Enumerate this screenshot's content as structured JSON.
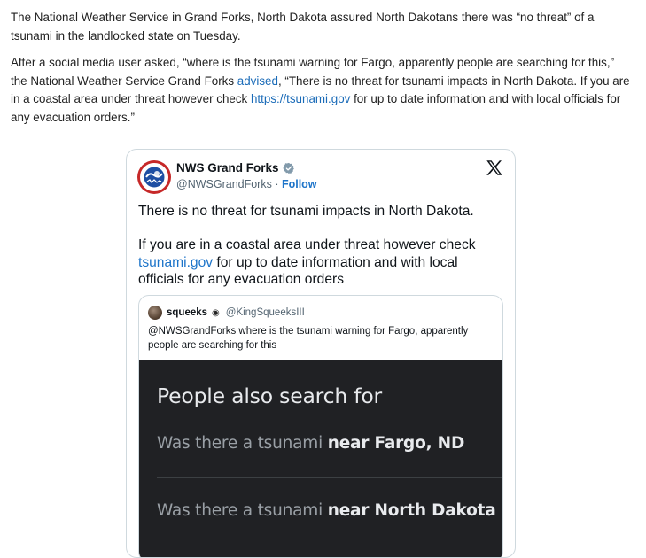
{
  "article": {
    "para1": "The National Weather Service in Grand Forks, North Dakota assured North Dakotans there was “no threat” of a tsunami in the landlocked state on Tuesday.",
    "para2_before": "After a social media user asked, “where is the tsunami warning for Fargo, apparently people are searching for this,” the National Weather Service Grand Forks ",
    "para2_link1": "advised",
    "para2_mid": ", “There is no threat for tsunami impacts in North Dakota. If you are in a coastal area under threat however check ",
    "para2_link2": "https://tsunami.gov",
    "para2_after": " for up to date information and with local officials for any evacuation orders.”"
  },
  "tweet": {
    "author_name": "NWS Grand Forks",
    "handle": "@NWSGrandForks",
    "separator": " · ",
    "follow_label": "Follow",
    "text_p1": "There is no threat for tsunami impacts in North Dakota.",
    "text_p2_before": "If you are in a coastal area under threat however check ",
    "text_p2_link": "tsunami.gov",
    "text_p2_after": " up to date information and with local officials for any evacuation orders",
    "text_p2_for": "for"
  },
  "quote": {
    "author_name": "squeeks",
    "badge": "◉",
    "handle": "@KingSqueeksIII",
    "text": "@NWSGrandForks where is the tsunami warning for Fargo, apparently people are searching for this",
    "image": {
      "title": "People also search for",
      "item1_prefix": "Was there a tsunami ",
      "item1_bold": "near Fargo, ND",
      "item2_prefix": "Was there a tsunami ",
      "item2_bold": "near North Dakota"
    }
  },
  "colors": {
    "link": "#1a6bb8",
    "tweet_link": "#1d74c9",
    "search_bg": "#202124"
  }
}
